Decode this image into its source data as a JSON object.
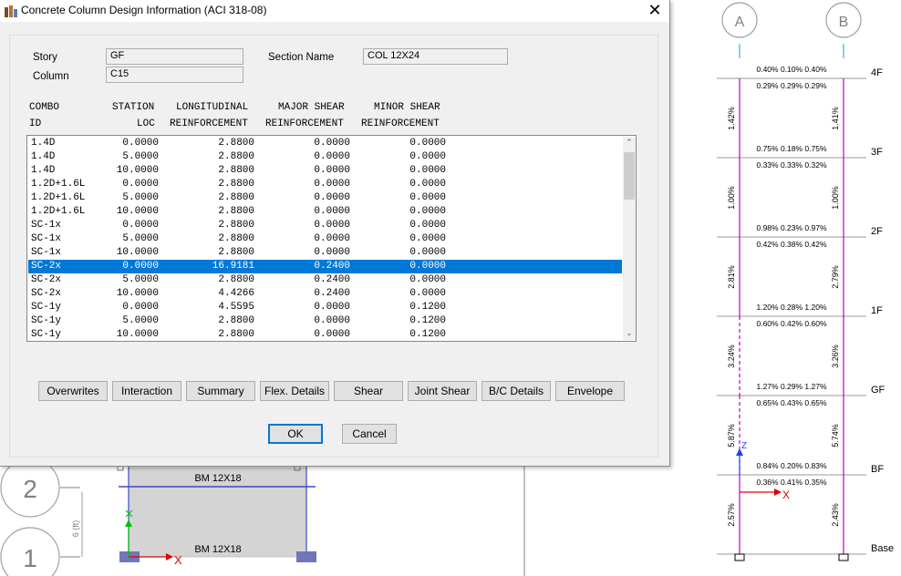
{
  "dialog": {
    "title": "Concrete Column Design Information (ACI 318-08)",
    "close_glyph": "✕",
    "story_label": "Story",
    "story_value": "GF",
    "column_label": "Column",
    "column_value": "C15",
    "section_label": "Section Name",
    "section_value": "COL 12X24",
    "headers": {
      "combo_1": "COMBO",
      "combo_2": "ID",
      "station_1": "STATION",
      "station_2": "LOC",
      "long_1": "LONGITUDINAL",
      "long_2": "REINFORCEMENT",
      "major_1": "MAJOR SHEAR",
      "major_2": "REINFORCEMENT",
      "minor_1": "MINOR SHEAR",
      "minor_2": "REINFORCEMENT"
    },
    "rows": [
      [
        "1.4D",
        "0.0000",
        "2.8800",
        "0.0000",
        "0.0000"
      ],
      [
        "1.4D",
        "5.0000",
        "2.8800",
        "0.0000",
        "0.0000"
      ],
      [
        "1.4D",
        "10.0000",
        "2.8800",
        "0.0000",
        "0.0000"
      ],
      [
        "1.2D+1.6L",
        "0.0000",
        "2.8800",
        "0.0000",
        "0.0000"
      ],
      [
        "1.2D+1.6L",
        "5.0000",
        "2.8800",
        "0.0000",
        "0.0000"
      ],
      [
        "1.2D+1.6L",
        "10.0000",
        "2.8800",
        "0.0000",
        "0.0000"
      ],
      [
        "SC-1x",
        "0.0000",
        "2.8800",
        "0.0000",
        "0.0000"
      ],
      [
        "SC-1x",
        "5.0000",
        "2.8800",
        "0.0000",
        "0.0000"
      ],
      [
        "SC-1x",
        "10.0000",
        "2.8800",
        "0.0000",
        "0.0000"
      ],
      [
        "SC-2x",
        "0.0000",
        "16.9181",
        "0.2400",
        "0.0000"
      ],
      [
        "SC-2x",
        "5.0000",
        "2.8800",
        "0.2400",
        "0.0000"
      ],
      [
        "SC-2x",
        "10.0000",
        "4.4266",
        "0.2400",
        "0.0000"
      ],
      [
        "SC-1y",
        "0.0000",
        "4.5595",
        "0.0000",
        "0.1200"
      ],
      [
        "SC-1y",
        "5.0000",
        "2.8800",
        "0.0000",
        "0.1200"
      ],
      [
        "SC-1y",
        "10.0000",
        "2.8800",
        "0.0000",
        "0.1200"
      ]
    ],
    "selected_row": 9,
    "buttons": [
      "Overwrites",
      "Interaction",
      "Summary",
      "Flex. Details",
      "Shear",
      "Joint Shear",
      "B/C Details",
      "Envelope"
    ],
    "ok_label": "OK",
    "cancel_label": "Cancel",
    "scroll_up": "⌃",
    "scroll_down": "⌄"
  },
  "plan": {
    "grid_2": "2",
    "grid_1": "1",
    "beam_top": "BM 12X18",
    "beam_bottom": "BM 12X18",
    "dim_label": "6 (ft)",
    "x_axis": "X"
  },
  "elevation": {
    "grid_a": "A",
    "grid_b": "B",
    "stories": [
      "4F",
      "3F",
      "2F",
      "1F",
      "GF",
      "BF",
      "Base"
    ],
    "beam_top_labels": [
      "0.40% 0.10% 0.40%",
      "0.75% 0.18% 0.75%",
      "0.98% 0.23% 0.97%",
      "1.20% 0.28% 1.20%",
      "1.27% 0.29% 1.27%",
      "0.84% 0.20% 0.83%"
    ],
    "beam_bottom_labels": [
      "0.29% 0.29% 0.29%",
      "0.33% 0.33% 0.32%",
      "0.42% 0.38% 0.42%",
      "0.60% 0.42% 0.60%",
      "0.65% 0.43% 0.65%",
      "0.36% 0.41% 0.35%"
    ],
    "col_a_labels": [
      "1.42%",
      "1.00%",
      "2.81%",
      "3.24%",
      "5.87%",
      "2.57%"
    ],
    "col_b_labels": [
      "1.41%",
      "1.00%",
      "2.79%",
      "3.26%",
      "5.74%",
      "2.43%"
    ],
    "x_axis": "X",
    "z_axis": "Z"
  },
  "colors": {
    "selection": "#0078d7",
    "column_line": "#c000c0",
    "beam_fill": "#d4d4d4",
    "beam_edge": "#3f48cc"
  }
}
